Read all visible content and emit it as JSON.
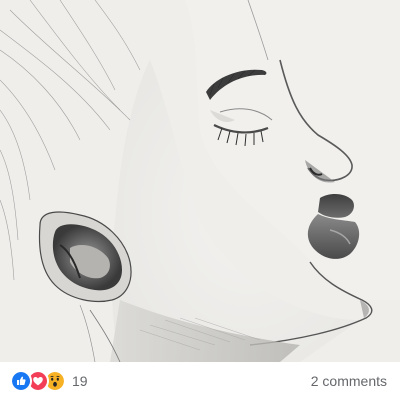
{
  "post": {
    "image": {
      "icon": "pencil-portrait-drawing",
      "paper_color": "#efeeeb",
      "line_color": "#6a6a6a"
    },
    "reactions": {
      "types": [
        "like",
        "love",
        "wow"
      ],
      "colors": {
        "like": "#1877f2",
        "love": "#f33e58",
        "wow": "#f7b125"
      },
      "count": "19"
    },
    "comments_label": "2 comments"
  }
}
